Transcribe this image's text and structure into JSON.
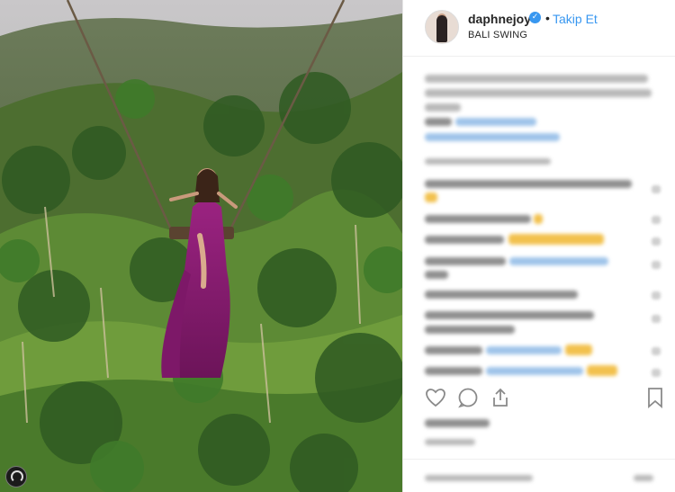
{
  "post": {
    "username": "daphnejoy",
    "verified_glyph": "✓",
    "separator": "•",
    "follow_label": "Takip Et",
    "location": "BALI SWING"
  },
  "icons": {
    "like": "heart-icon",
    "comment": "comment-icon",
    "share": "share-icon",
    "save": "bookmark-icon"
  },
  "colors": {
    "link_blue": "#3897f0",
    "text": "#262626",
    "dress_purple": "#8a1b73"
  }
}
